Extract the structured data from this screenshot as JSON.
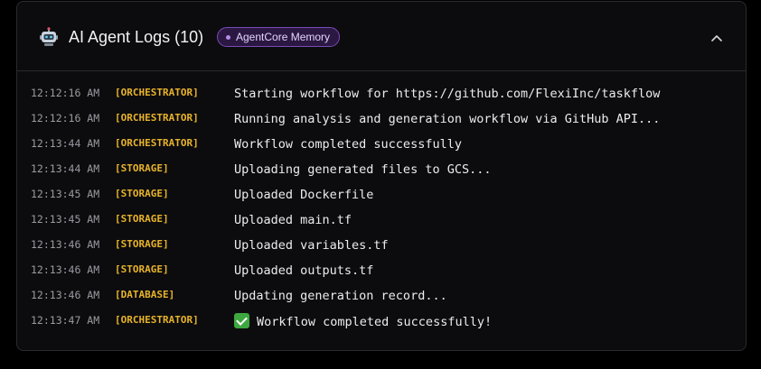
{
  "header": {
    "title": "AI Agent Logs (10)",
    "badge": "AgentCore Memory",
    "icon": "robot-icon",
    "collapse_icon": "chevron-up-icon"
  },
  "colors": {
    "background": "#0c0c0e",
    "agent_tag": "#e8b32a",
    "badge_border": "#7b4ab8",
    "badge_bg": "#2a1842"
  },
  "logs": [
    {
      "time": "12:12:16 AM",
      "agent": "[ORCHESTRATOR]",
      "message": "Starting workflow for https://github.com/FlexiInc/taskflow"
    },
    {
      "time": "12:12:16 AM",
      "agent": "[ORCHESTRATOR]",
      "message": "Running analysis and generation workflow via GitHub API..."
    },
    {
      "time": "12:13:44 AM",
      "agent": "[ORCHESTRATOR]",
      "message": "Workflow completed successfully"
    },
    {
      "time": "12:13:44 AM",
      "agent": "[STORAGE]",
      "message": "Uploading generated files to GCS..."
    },
    {
      "time": "12:13:45 AM",
      "agent": "[STORAGE]",
      "message": "Uploaded Dockerfile"
    },
    {
      "time": "12:13:45 AM",
      "agent": "[STORAGE]",
      "message": "Uploaded main.tf"
    },
    {
      "time": "12:13:46 AM",
      "agent": "[STORAGE]",
      "message": "Uploaded variables.tf"
    },
    {
      "time": "12:13:46 AM",
      "agent": "[STORAGE]",
      "message": "Uploaded outputs.tf"
    },
    {
      "time": "12:13:46 AM",
      "agent": "[DATABASE]",
      "message": "Updating generation record..."
    },
    {
      "time": "12:13:47 AM",
      "agent": "[ORCHESTRATOR]",
      "message": "Workflow completed successfully!",
      "icon": "check-mark-icon"
    }
  ]
}
